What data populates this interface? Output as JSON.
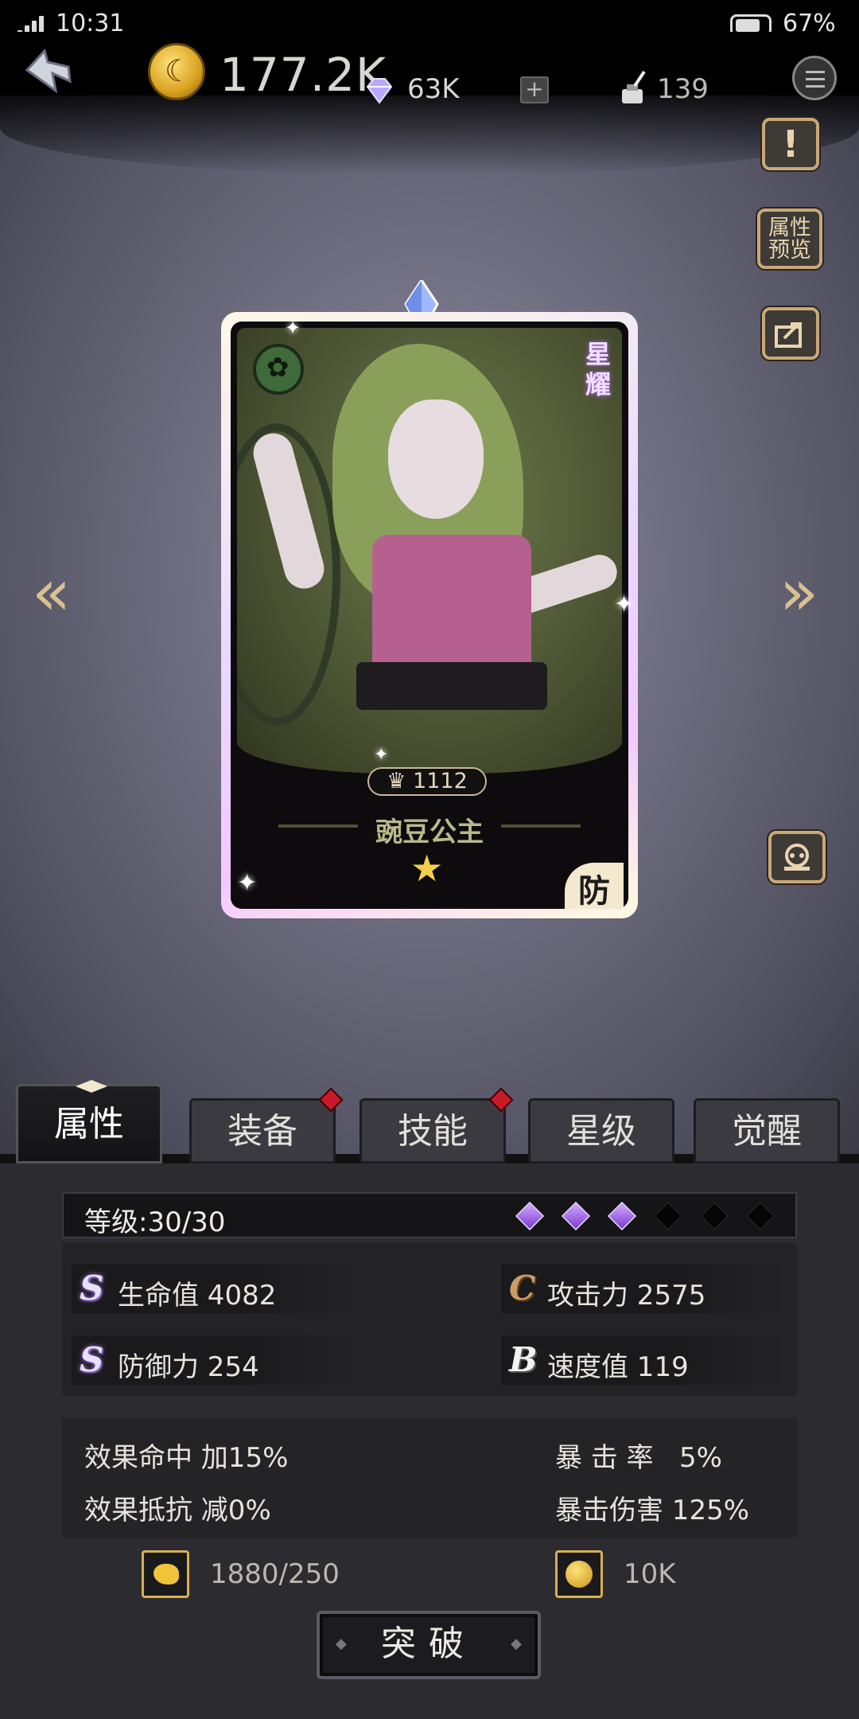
{
  "status_bar": {
    "time": "10:31",
    "battery": "67%"
  },
  "resources": {
    "gold": "177.2K",
    "gems": "63K",
    "ink": "139"
  },
  "side_buttons": {
    "preview_label": "属性\n预览"
  },
  "hero": {
    "star_label": "星耀",
    "power": "1112",
    "name": "豌豆公主",
    "stars": "★",
    "role": "防"
  },
  "tabs": [
    {
      "label": "属性",
      "active": true,
      "badge": false
    },
    {
      "label": "装备",
      "active": false,
      "badge": true
    },
    {
      "label": "技能",
      "active": false,
      "badge": true
    },
    {
      "label": "星级",
      "active": false,
      "badge": false
    },
    {
      "label": "觉醒",
      "active": false,
      "badge": false
    }
  ],
  "level": {
    "text": "等级:30/30",
    "gems_filled": 3,
    "gems_total": 6
  },
  "main_stats": [
    {
      "grade": "S",
      "label": "生命值 4082"
    },
    {
      "grade": "C",
      "label": "攻击力 2575"
    },
    {
      "grade": "S",
      "label": "防御力 254"
    },
    {
      "grade": "B",
      "label": "速度值 119"
    }
  ],
  "sub_stats": {
    "effect_hit": "效果命中  加15%",
    "crit_rate": "暴 击 率   5%",
    "effect_resist": "效果抵抗  减0%",
    "crit_damage": "暴击伤害  125%"
  },
  "costs": {
    "material": "1880/250",
    "gold": "10K"
  },
  "breakthrough_label": "突破",
  "colors": {
    "accent_gold": "#c9a878",
    "gem_purple": "#7a3bd0",
    "badge_red": "#c81a28"
  }
}
